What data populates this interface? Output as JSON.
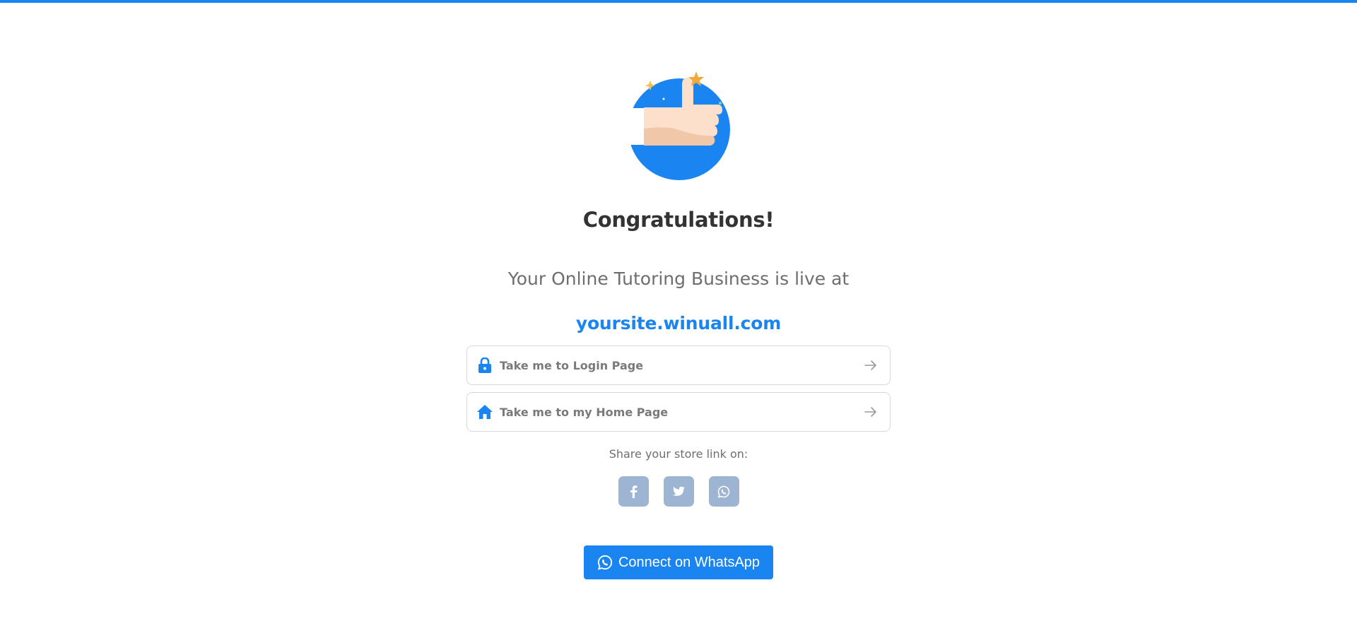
{
  "colors": {
    "accent": "#1a85f0",
    "social_button": "#9db5d2",
    "muted_text": "#6e6e6e",
    "heading_text": "#333333"
  },
  "hero": {
    "icon": "thumbs-up-icon"
  },
  "title": "Congratulations!",
  "subtitle": "Your Online Tutoring Business is live at",
  "site_link": "yoursite.winuall.com",
  "actions": [
    {
      "label": "Take me to Login Page",
      "icon": "lock-icon"
    },
    {
      "label": "Take me to my Home Page",
      "icon": "home-icon"
    }
  ],
  "share": {
    "label": "Share your store link on:",
    "networks": [
      "facebook-icon",
      "twitter-icon",
      "whatsapp-icon"
    ]
  },
  "whatsapp_button": {
    "label": "Connect on WhatsApp",
    "icon": "whatsapp-icon"
  }
}
